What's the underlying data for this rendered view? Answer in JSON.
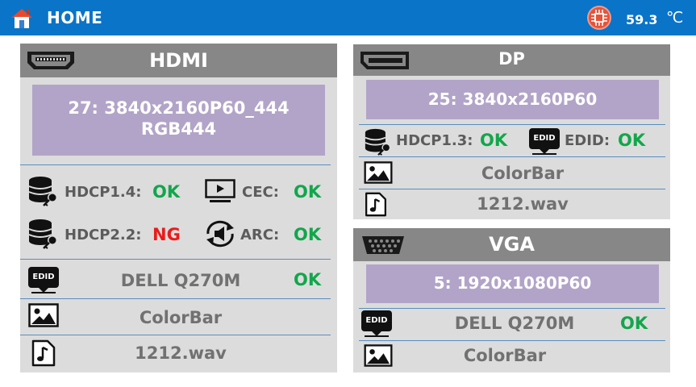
{
  "header": {
    "title": "HOME",
    "temperature": "59.3",
    "temperature_unit": "℃",
    "icons": [
      "home-icon",
      "cpu-chip-icon"
    ]
  },
  "hdmi": {
    "title": "HDMI",
    "resolution_line1": "27: 3840x2160P60_444",
    "resolution_line2": "RGB444",
    "hdcp14_label": "HDCP1.4:",
    "hdcp14_status": "OK",
    "cec_label": "CEC:",
    "cec_status": "OK",
    "hdcp22_label": "HDCP2.2:",
    "hdcp22_status": "NG",
    "arc_label": "ARC:",
    "arc_status": "OK",
    "edid_badge": "EDID",
    "edid_monitor": "DELL Q270M",
    "edid_status": "OK",
    "pattern": "ColorBar",
    "audio": "1212.wav"
  },
  "dp": {
    "title": "DP",
    "resolution": "25: 3840x2160P60",
    "hdcp13_label": "HDCP1.3:",
    "hdcp13_status": "OK",
    "edid_badge": "EDID",
    "edid_label": "EDID:",
    "edid_status": "OK",
    "pattern": "ColorBar",
    "audio": "1212.wav"
  },
  "vga": {
    "title": "VGA",
    "resolution": "5: 1920x1080P60",
    "edid_badge": "EDID",
    "edid_monitor": "DELL Q270M",
    "edid_status": "OK",
    "pattern": "ColorBar"
  },
  "colors": {
    "header_bg": "#0a74c9",
    "panel_bg": "#dcdcdc",
    "panel_header": "#878787",
    "resolution_box": "#b2a4c8",
    "ok": "#12a64b",
    "ng": "#ea1b1b",
    "separator": "#5a8dbd"
  }
}
